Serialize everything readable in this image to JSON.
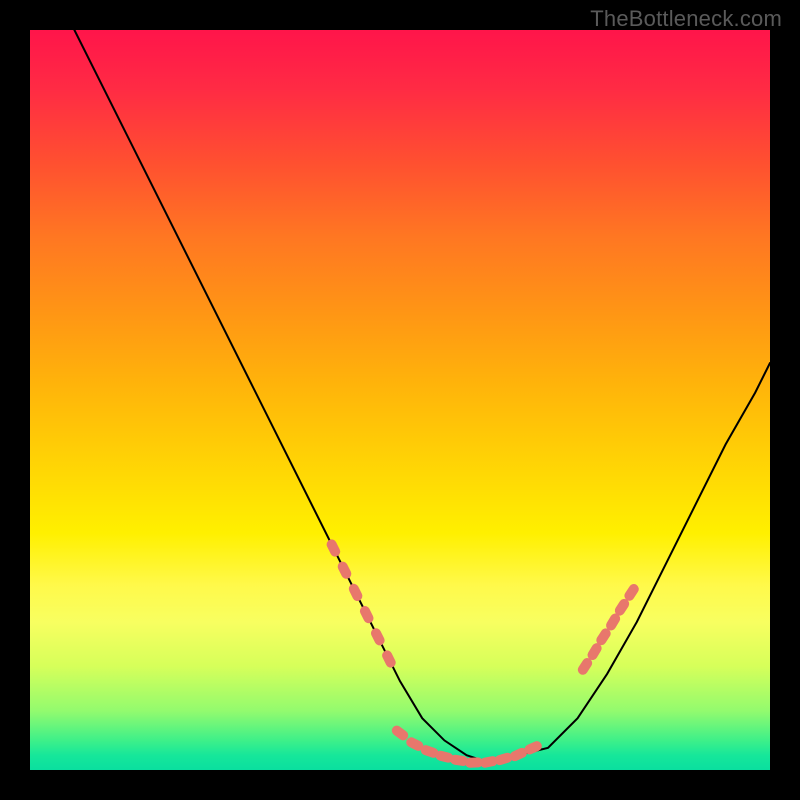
{
  "watermark": "TheBottleneck.com",
  "chart_data": {
    "type": "line",
    "title": "",
    "xlabel": "",
    "ylabel": "",
    "xlim": [
      0,
      100
    ],
    "ylim": [
      0,
      100
    ],
    "series": [
      {
        "name": "curve",
        "x": [
          6,
          10,
          15,
          20,
          25,
          30,
          35,
          40,
          44,
          47,
          50,
          53,
          56,
          59,
          62,
          64,
          66,
          70,
          74,
          78,
          82,
          86,
          90,
          94,
          98,
          100
        ],
        "y": [
          100,
          92,
          82,
          72,
          62,
          52,
          42,
          32,
          24,
          18,
          12,
          7,
          4,
          2,
          1,
          1,
          2,
          3,
          7,
          13,
          20,
          28,
          36,
          44,
          51,
          55
        ]
      }
    ],
    "markers": [
      {
        "name": "left-dots",
        "x": [
          41,
          42.5,
          44,
          45.5,
          47,
          48.5
        ],
        "y": [
          30,
          27,
          24,
          21,
          18,
          15
        ]
      },
      {
        "name": "bottom-dots",
        "x": [
          50,
          52,
          54,
          56,
          58,
          60,
          62,
          64,
          66,
          68
        ],
        "y": [
          5,
          3.5,
          2.5,
          1.8,
          1.3,
          1,
          1.1,
          1.5,
          2.1,
          3
        ]
      },
      {
        "name": "right-dots",
        "x": [
          75,
          76.3,
          77.5,
          78.8,
          80,
          81.3
        ],
        "y": [
          14,
          16,
          18,
          20,
          22,
          24
        ]
      }
    ]
  }
}
